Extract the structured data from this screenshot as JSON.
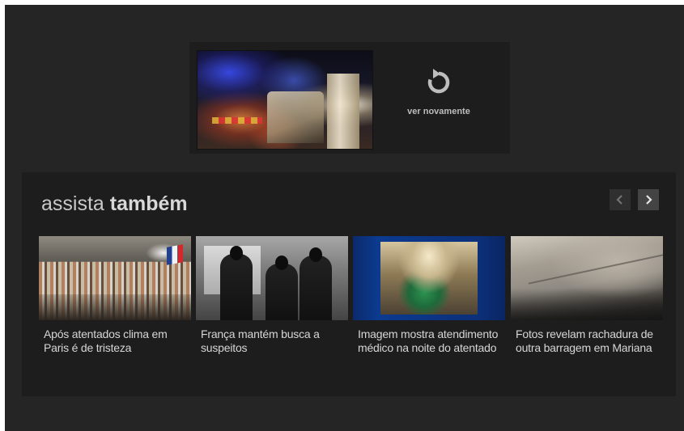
{
  "replay": {
    "label": "ver novamente",
    "icon": "replay-icon"
  },
  "also_watch": {
    "title_light": "assista",
    "title_bold": "também",
    "prev_icon": "chevron-left-icon",
    "next_icon": "chevron-right-icon",
    "videos": [
      {
        "title": "Após atentados clima em Paris é de tristeza"
      },
      {
        "title": "França mantém busca a suspeitos"
      },
      {
        "title": "Imagem mostra atendimento médico na noite do atentado"
      },
      {
        "title": "Fotos revelam rachadura de outra barragem em Mariana"
      }
    ]
  },
  "colors": {
    "background": "#252525",
    "panel": "#1d1d1d",
    "text": "#d6d6d6"
  }
}
